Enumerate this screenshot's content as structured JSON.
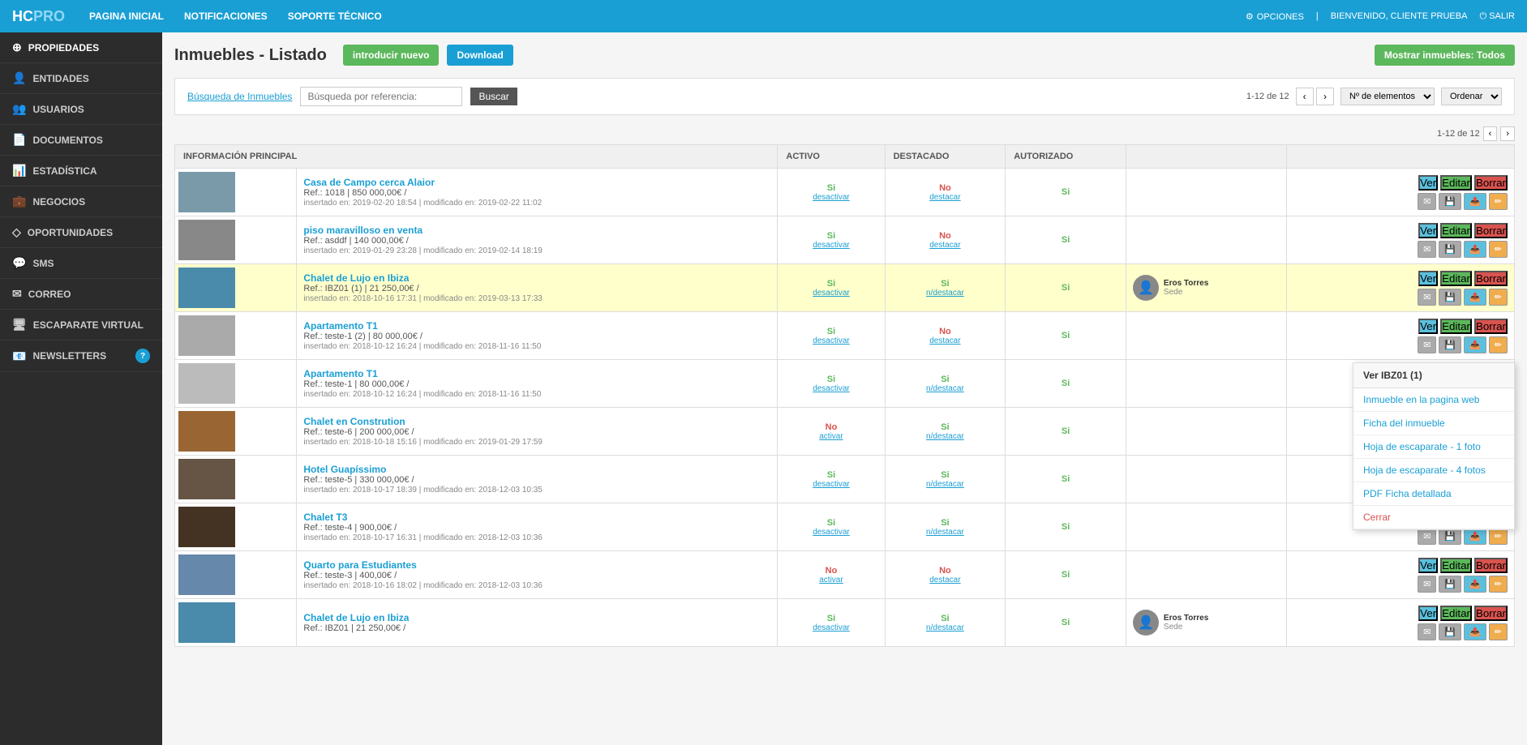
{
  "topnav": {
    "logo": "HCPRO",
    "links": [
      "PAGINA INICIAL",
      "NOTIFICACIONES",
      "SOPORTE TÉCNICO"
    ],
    "options_label": "OPCIONES",
    "welcome_label": "BIENVENIDO, CLIENTE PRUEBA",
    "salir_label": "SALIR"
  },
  "sidebar": {
    "items": [
      {
        "id": "propiedades",
        "label": "PROPIEDADES",
        "icon": "⊕",
        "active": true
      },
      {
        "id": "entidades",
        "label": "ENTIDADES",
        "icon": "👤"
      },
      {
        "id": "usuarios",
        "label": "USUARIOS",
        "icon": "👥"
      },
      {
        "id": "documentos",
        "label": "DOCUMENTOS",
        "icon": "📄"
      },
      {
        "id": "estadistica",
        "label": "ESTADÍSTICA",
        "icon": "📊"
      },
      {
        "id": "negocios",
        "label": "NEGOCIOS",
        "icon": "💼"
      },
      {
        "id": "oportunidades",
        "label": "OPORTUNIDADES",
        "icon": "◇"
      },
      {
        "id": "sms",
        "label": "SMS",
        "icon": "💬"
      },
      {
        "id": "correo",
        "label": "CORREO",
        "icon": "✉"
      },
      {
        "id": "escaparate",
        "label": "ESCAPARATE VIRTUAL",
        "icon": "🖥"
      },
      {
        "id": "newsletters",
        "label": "NEWSLETTERS",
        "icon": "📧",
        "badge": "?"
      }
    ]
  },
  "page": {
    "title": "Inmuebles - Listado",
    "btn_new": "introducir nuevo",
    "btn_download": "Download",
    "btn_mostrar": "Mostrar inmuebles: Todos",
    "search_link": "Búsqueda de Inmuebles",
    "search_placeholder": "Búsqueda por referencia:",
    "btn_buscar": "Buscar",
    "pagination_text": "1-12 de 12",
    "elementos_label": "Nº de elementos",
    "ordenar_label": "Ordenar",
    "table_pagination": "1-12 de 12",
    "col_info": "INFORMACIÓN PRINCIPAL",
    "col_activo": "ACTIVO",
    "col_destacado": "DESTACADO",
    "col_autorizado": "AUTORIZADO"
  },
  "dropdown": {
    "header": "Ver IBZ01 (1)",
    "items": [
      {
        "label": "Inmueble en la pagina web",
        "red": false
      },
      {
        "label": "Ficha del inmueble",
        "red": false
      },
      {
        "label": "Hoja de escaparate - 1 foto",
        "red": false
      },
      {
        "label": "Hoja de escaparate - 4 fotos",
        "red": false
      },
      {
        "label": "PDF Ficha detallada",
        "red": false
      },
      {
        "label": "Cerrar",
        "red": true
      }
    ]
  },
  "properties": [
    {
      "id": 1,
      "title": "Casa de Campo cerca Alaior",
      "ref": "Ref.: 1018 | 850 000,00€ /",
      "date": "insertado en: 2019-02-20 18:54 | modificado en: 2019-02-22 11:02",
      "activo": "Si",
      "activo_link": "desactivar",
      "destacado": "No",
      "destacado_link": "destacar",
      "autorizado": "Si",
      "agent": "",
      "agent_name": "",
      "agent_role": "",
      "highlighted": false,
      "img_color": "#7a9aaa"
    },
    {
      "id": 2,
      "title": "piso maravilloso en venta",
      "ref": "Ref.: asddf | 140 000,00€ /",
      "date": "insertado en: 2019-01-29 23:28 | modificado en: 2019-02-14 18:19",
      "activo": "Si",
      "activo_link": "desactivar",
      "destacado": "No",
      "destacado_link": "destacar",
      "autorizado": "Si",
      "agent": "",
      "agent_name": "",
      "agent_role": "",
      "highlighted": false,
      "img_color": "#888"
    },
    {
      "id": 3,
      "title": "Chalet de Lujo en Ibiza",
      "ref": "Ref.: IBZ01 (1) | 21 250,00€ /",
      "date": "insertado en: 2018-10-16 17:31 | modificado en: 2019-03-13 17:33",
      "activo": "Si",
      "activo_link": "desactivar",
      "destacado": "Si",
      "destacado_link": "n/destacar",
      "autorizado": "Si",
      "agent": "Eros Torres",
      "agent_name": "Eros Torres",
      "agent_role": "Sede",
      "highlighted": true,
      "img_color": "#4a8aaa"
    },
    {
      "id": 4,
      "title": "Apartamento T1",
      "ref": "Ref.: teste-1 (2) | 80 000,00€ /",
      "date": "insertado en: 2018-10-12 16:24 | modificado en: 2018-11-16 11:50",
      "activo": "Si",
      "activo_link": "desactivar",
      "destacado": "No",
      "destacado_link": "destacar",
      "autorizado": "Si",
      "agent": "",
      "agent_name": "",
      "agent_role": "",
      "highlighted": false,
      "img_color": "#aaa"
    },
    {
      "id": 5,
      "title": "Apartamento T1",
      "ref": "Ref.: teste-1 | 80 000,00€ /",
      "date": "insertado en: 2018-10-12 16:24 | modificado en: 2018-11-16 11:50",
      "activo": "Si",
      "activo_link": "desactivar",
      "destacado": "Si",
      "destacado_link": "n/destacar",
      "autorizado": "Si",
      "agent": "",
      "agent_name": "",
      "agent_role": "",
      "highlighted": false,
      "img_color": "#bbb"
    },
    {
      "id": 6,
      "title": "Chalet en Constrution",
      "ref": "Ref.: teste-6 | 200 000,00€ /",
      "date": "insertado en: 2018-10-18 15:16 | modificado en: 2019-01-29 17:59",
      "activo": "No",
      "activo_link": "activar",
      "destacado": "Si",
      "destacado_link": "n/destacar",
      "autorizado": "Si",
      "agent": "",
      "agent_name": "",
      "agent_role": "",
      "highlighted": false,
      "img_color": "#996633",
      "has_badge": true
    },
    {
      "id": 7,
      "title": "Hotel Guapíssimo",
      "ref": "Ref.: teste-5 | 330 000,00€ /",
      "date": "insertado en: 2018-10-17 18:39 | modificado en: 2018-12-03 10:35",
      "activo": "Si",
      "activo_link": "desactivar",
      "destacado": "Si",
      "destacado_link": "n/destacar",
      "autorizado": "Si",
      "agent": "",
      "agent_name": "",
      "agent_role": "",
      "highlighted": false,
      "img_color": "#665544"
    },
    {
      "id": 8,
      "title": "Chalet T3",
      "ref": "Ref.: teste-4 | 900,00€ /",
      "date": "insertado en: 2018-10-17 16:31 | modificado en: 2018-12-03 10:36",
      "activo": "Si",
      "activo_link": "desactivar",
      "destacado": "Si",
      "destacado_link": "n/destacar",
      "autorizado": "Si",
      "agent": "",
      "agent_name": "",
      "agent_role": "",
      "highlighted": false,
      "img_color": "#443322"
    },
    {
      "id": 9,
      "title": "Quarto para Estudiantes",
      "ref": "Ref.: teste-3 | 400,00€ /",
      "date": "insertado en: 2018-10-16 18:02 | modificado en: 2018-12-03 10:36",
      "activo": "No",
      "activo_link": "activar",
      "destacado": "No",
      "destacado_link": "destacar",
      "autorizado": "Si",
      "agent": "",
      "agent_name": "",
      "agent_role": "",
      "highlighted": false,
      "img_color": "#6688aa"
    },
    {
      "id": 10,
      "title": "Chalet de Lujo en Ibiza",
      "ref": "Ref.: IBZ01 | 21 250,00€ /",
      "date": "",
      "activo": "Si",
      "activo_link": "desactivar",
      "destacado": "Si",
      "destacado_link": "n/destacar",
      "autorizado": "Si",
      "agent": "Eros Torres",
      "agent_name": "Eros Torres",
      "agent_role": "Sede",
      "highlighted": false,
      "img_color": "#4a8aaa"
    }
  ]
}
